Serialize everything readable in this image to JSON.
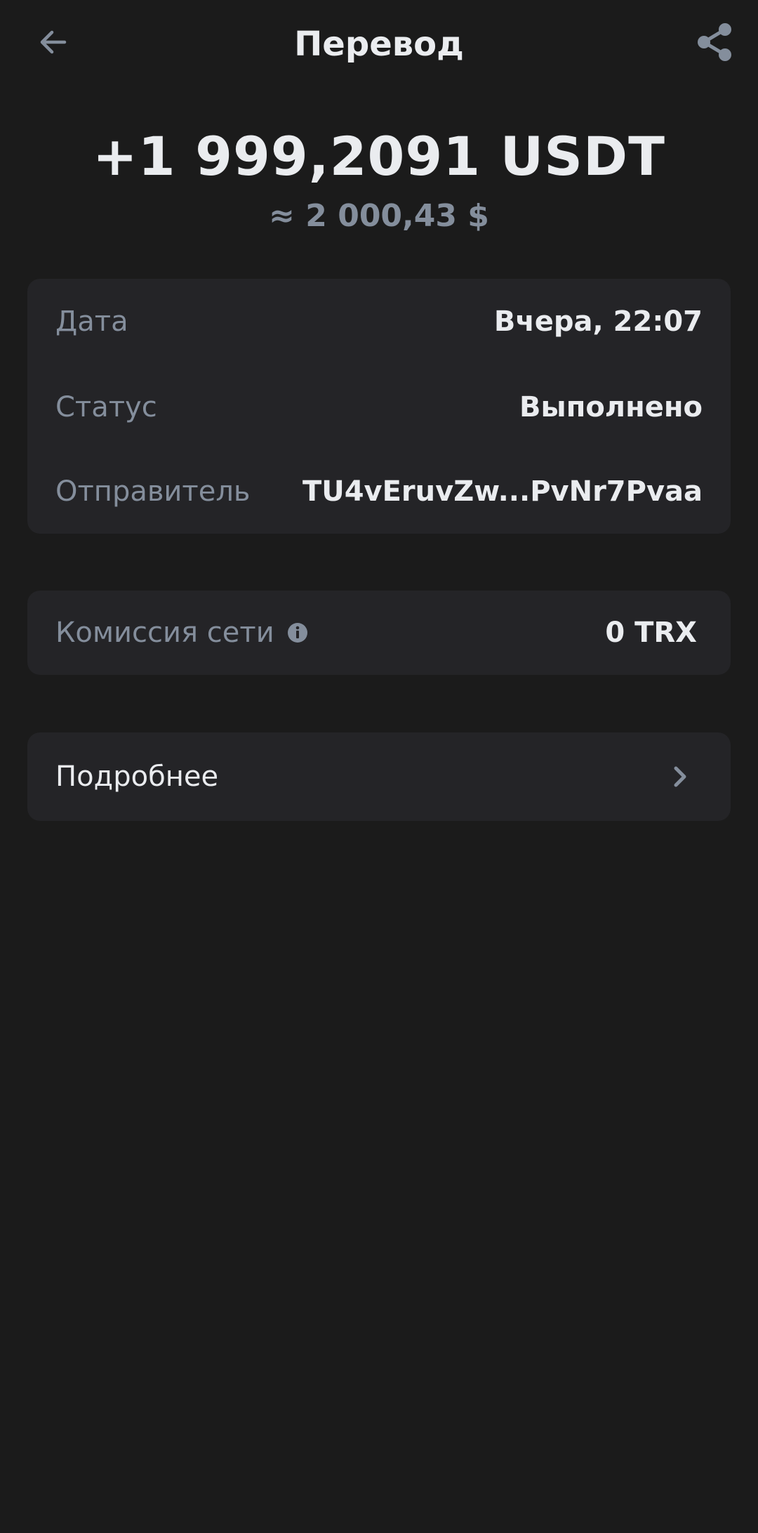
{
  "header": {
    "title": "Перевод",
    "back_icon": "arrow-left-icon",
    "share_icon": "share-icon"
  },
  "transaction": {
    "amount": "+1 999,2091 USDT",
    "fiat_equivalent": "≈ 2 000,43 $"
  },
  "details": {
    "rows": [
      {
        "label": "Дата",
        "value": "Вчера, 22:07"
      },
      {
        "label": "Статус",
        "value": "Выполнено"
      },
      {
        "label": "Отправитель",
        "value": "TU4vEruvZw...PvNr7Pvaa"
      }
    ]
  },
  "fee": {
    "label": "Комиссия сети",
    "value": "0 TRX",
    "info_icon": "info-icon"
  },
  "more": {
    "label": "Подробнее",
    "chevron_icon": "chevron-right-icon"
  },
  "colors": {
    "background": "#1b1b1b",
    "card": "#242427",
    "primary_text": "#eaecef",
    "secondary_text": "#848e9c"
  }
}
